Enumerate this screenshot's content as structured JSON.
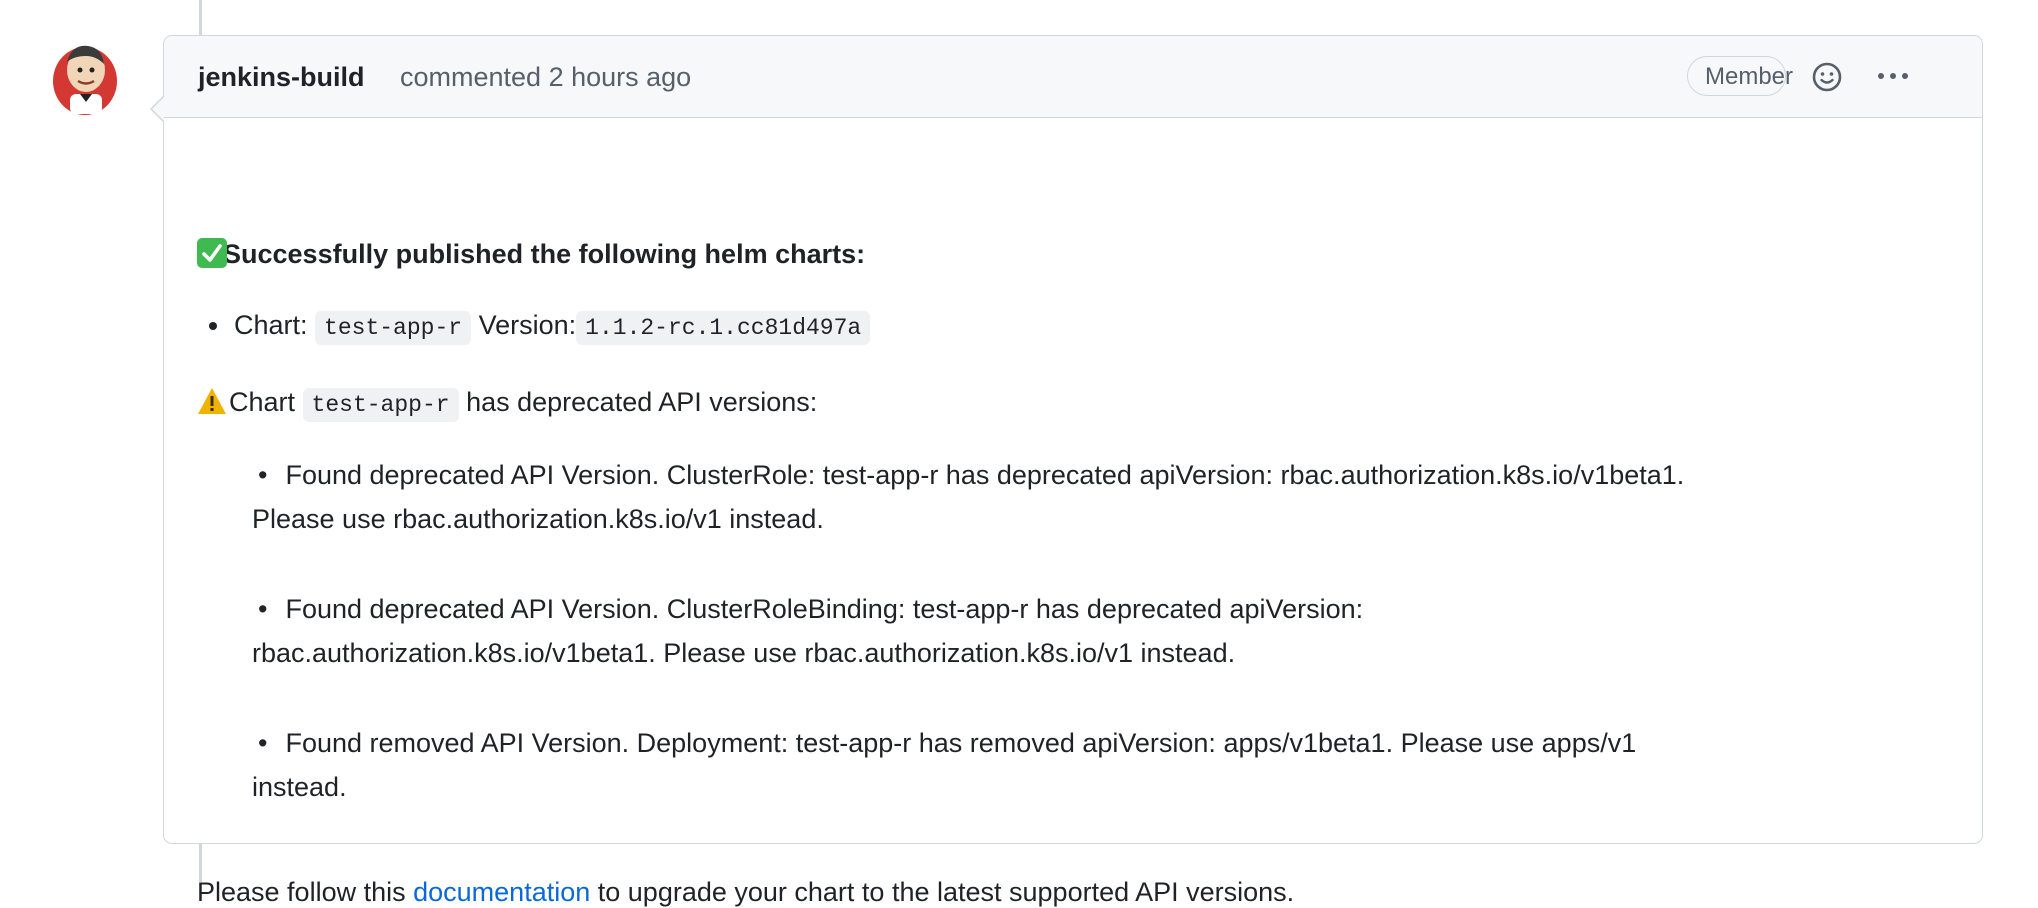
{
  "comment": {
    "author": "jenkins-build",
    "action_text": "commented 2 hours ago",
    "badge": "Member",
    "emoji_button_icon": "smiley-icon",
    "more_button_icon": "kebab-horizontal-icon"
  },
  "body": {
    "success_icon": "white-check-mark-emoji",
    "success_text": "Successfully published the following helm charts:",
    "chart_item": {
      "chart_label": "Chart:",
      "chart_name": "test-app-r",
      "version_label": "Version:",
      "version_value": "1.1.2-rc.1.cc81d497a"
    },
    "warning": {
      "icon": "warning-emoji",
      "prefix": "Chart",
      "chart_name": "test-app-r",
      "suffix": "has deprecated API versions:"
    },
    "deprecations": [
      {
        "line1": "Found deprecated API Version. ClusterRole: test-app-r has deprecated apiVersion: rbac.authorization.k8s.io/v1beta1.",
        "line2": "Please use rbac.authorization.k8s.io/v1 instead."
      },
      {
        "line1": "Found deprecated API Version. ClusterRoleBinding: test-app-r has deprecated apiVersion:",
        "line2": "rbac.authorization.k8s.io/v1beta1. Please use rbac.authorization.k8s.io/v1 instead."
      },
      {
        "line1": "Found removed API Version. Deployment: test-app-r has removed apiVersion: apps/v1beta1. Please use apps/v1",
        "line2": "instead."
      }
    ],
    "footer": {
      "prefix": "Please follow this",
      "link_text": "documentation",
      "suffix": "to upgrade your chart to the latest supported API versions."
    }
  },
  "colors": {
    "link": "#0969da",
    "border": "#d0d7de",
    "header_bg": "#f6f8fa",
    "success_green": "#3fb950",
    "warning_yellow": "#f0b400"
  }
}
